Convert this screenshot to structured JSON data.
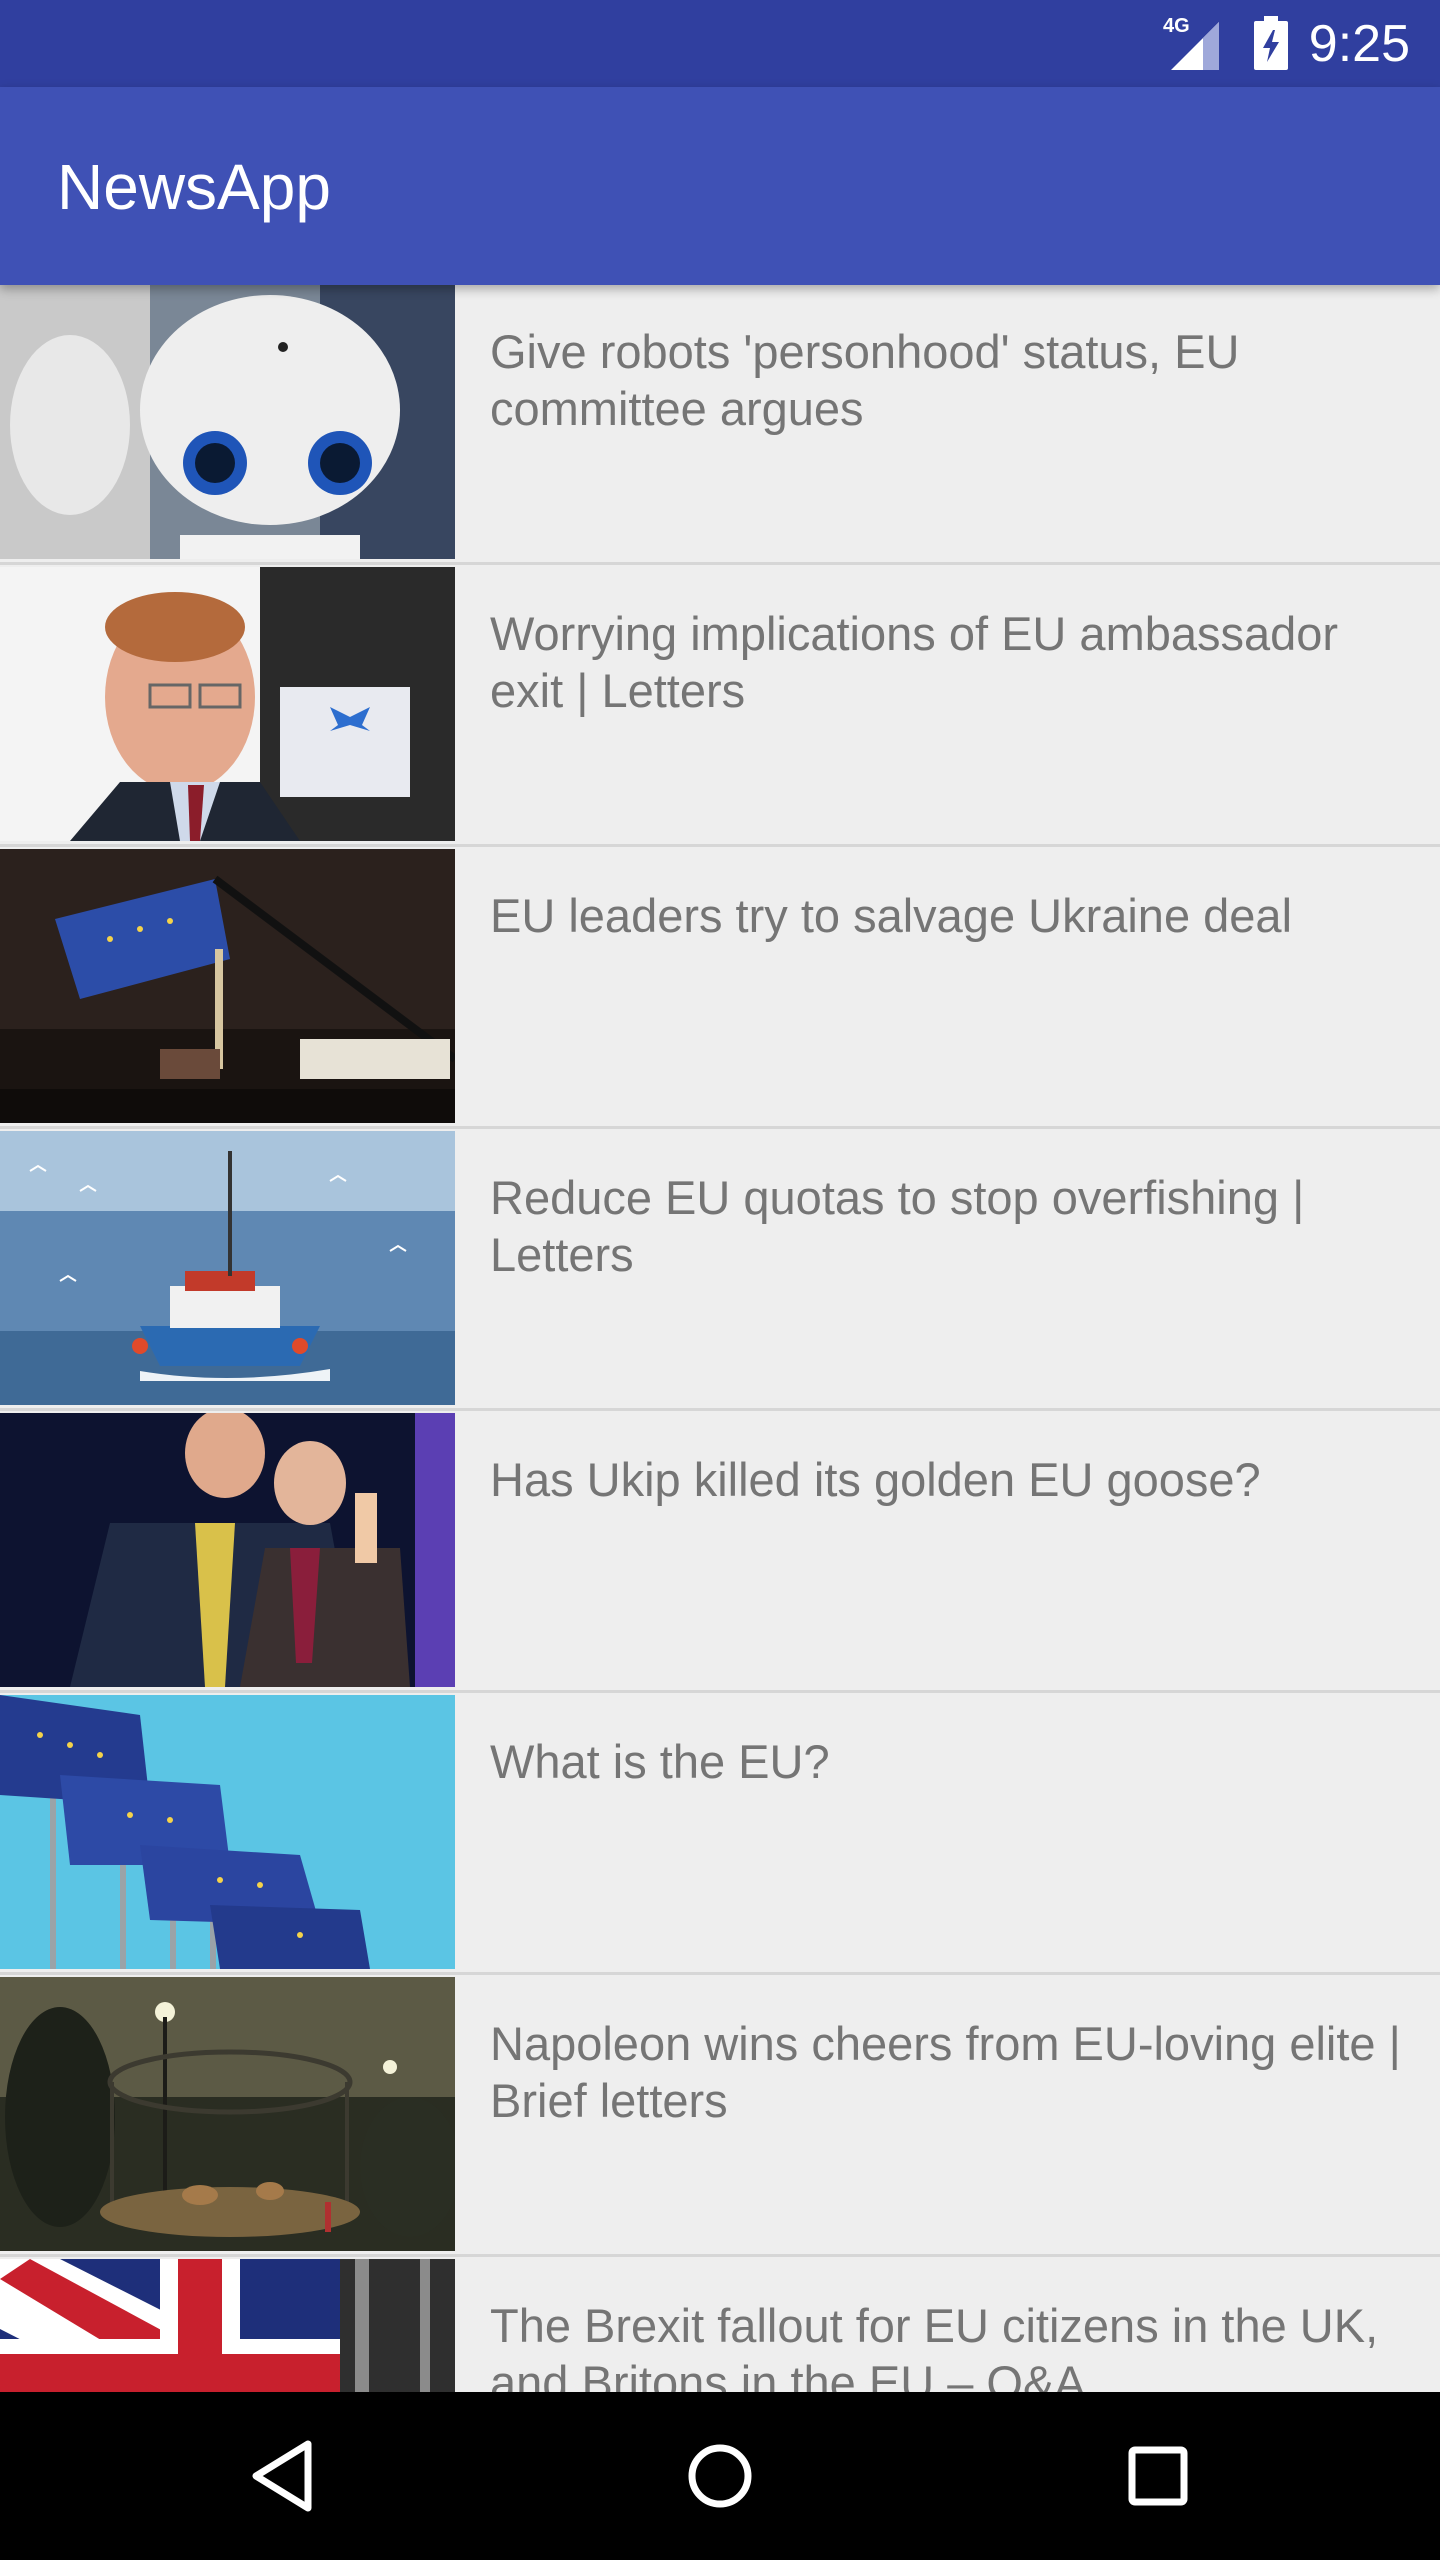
{
  "status_bar": {
    "network_label": "4G",
    "time": "9:25",
    "icons": [
      "signal-icon",
      "battery-charging-icon"
    ]
  },
  "app_bar": {
    "title": "NewsApp"
  },
  "articles": [
    {
      "title": "Give robots 'personhood' status, EU committee argues",
      "thumbnail": "robot-photo"
    },
    {
      "title": "Worrying implications of EU ambassador exit | Letters",
      "thumbnail": "ambassador-photo"
    },
    {
      "title": "EU leaders try to salvage Ukraine deal",
      "thumbnail": "eu-flag-night-photo"
    },
    {
      "title": "Reduce EU quotas to stop overfishing | Letters",
      "thumbnail": "fishing-boat-photo"
    },
    {
      "title": "Has Ukip killed its golden EU goose?",
      "thumbnail": "politicians-photo"
    },
    {
      "title": "What is the EU?",
      "thumbnail": "eu-flags-photo"
    },
    {
      "title": "Napoleon wins cheers from EU-loving elite | Brief letters",
      "thumbnail": "park-night-photo"
    },
    {
      "title": "The Brexit fallout for EU citizens in the UK, and Britons in the EU – Q&A",
      "thumbnail": "union-jack-photo"
    }
  ],
  "nav_bar": {
    "buttons": [
      "back-icon",
      "home-icon",
      "recents-icon"
    ]
  },
  "colors": {
    "status_bar": "#303f9f",
    "app_bar": "#3f51b5",
    "background": "#eeeeee",
    "headline_text": "#757575",
    "nav_bar": "#000000"
  }
}
